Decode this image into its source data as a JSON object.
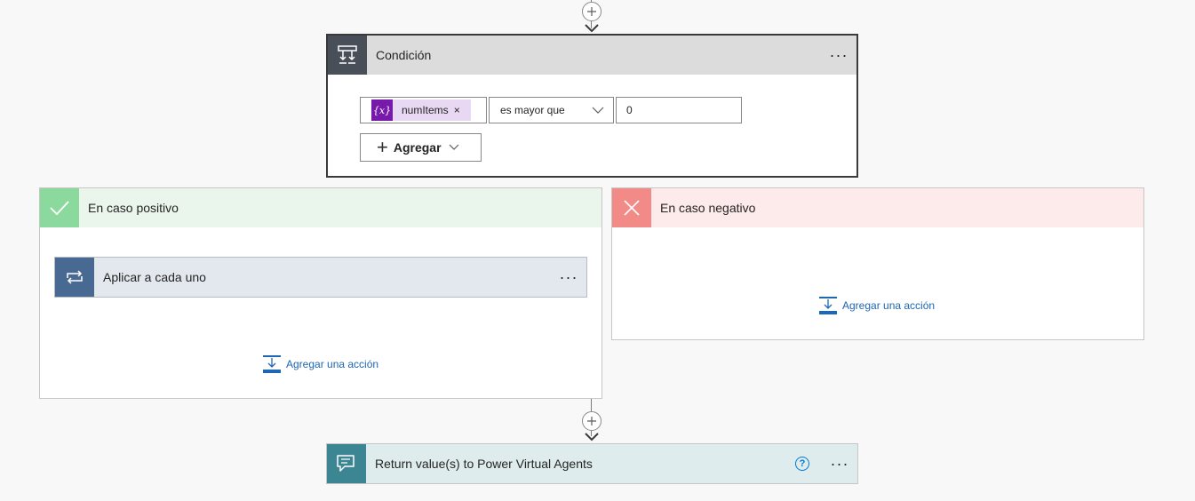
{
  "condition": {
    "title": "Condición",
    "token_label": "numItems",
    "token_icon_text": "{x}",
    "token_remove": "×",
    "operator": "es mayor que",
    "value": "0",
    "add_button_label": "Agregar",
    "more": "···"
  },
  "yes_branch": {
    "title": "En caso positivo",
    "foreach_title": "Aplicar a cada uno",
    "foreach_more": "···",
    "add_action": "Agregar una acción"
  },
  "no_branch": {
    "title": "En caso negativo",
    "add_action": "Agregar una acción"
  },
  "return_card": {
    "title": "Return value(s) to Power Virtual Agents",
    "help": "?",
    "more": "···"
  },
  "colors": {
    "condition_header": "#dcdcdc",
    "yes_header": "#eaf6ec",
    "yes_icon": "#8cd99e",
    "no_header": "#fdeaea",
    "no_icon": "#f28b87",
    "foreach_icon": "#486991",
    "return_icon": "#3c8592",
    "token": "#7719aa",
    "link": "#1f66b3"
  },
  "icons": {
    "condition": "condition-icon",
    "check": "check-icon",
    "close": "close-icon",
    "loop": "loop-icon",
    "chat": "chat-icon",
    "add_step": "plus-icon",
    "add_action": "add-action-icon",
    "help": "help-icon",
    "chevron": "chevron-down-icon"
  }
}
